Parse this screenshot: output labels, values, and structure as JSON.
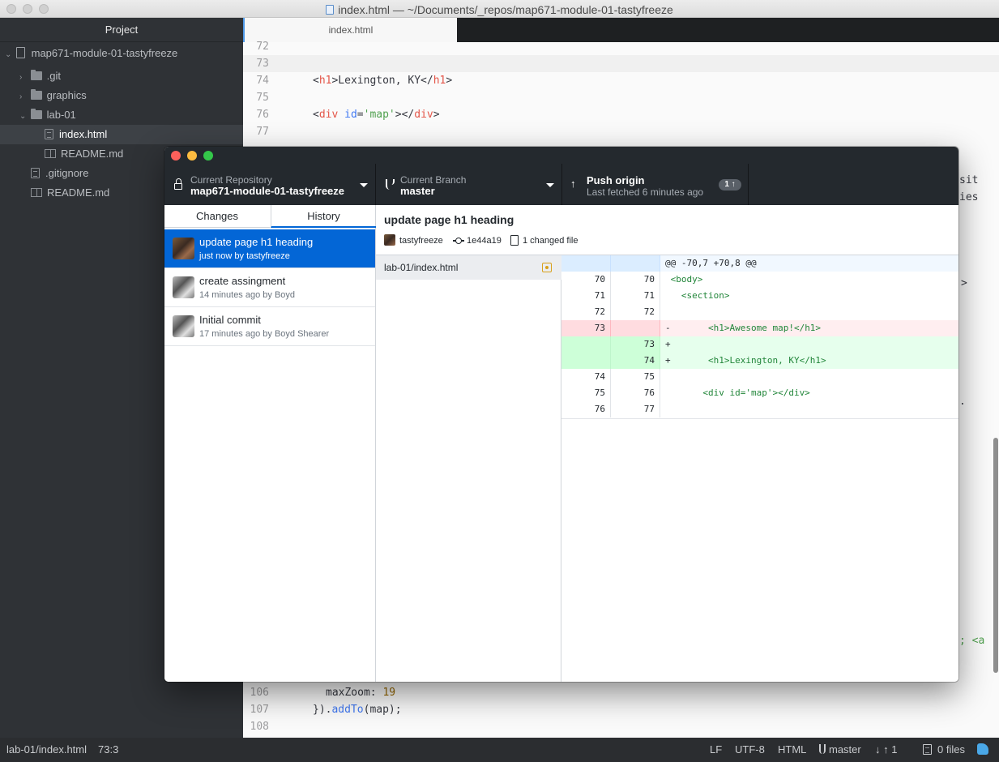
{
  "atom": {
    "window_title": "index.html — ~/Documents/_repos/map671-module-01-tastyfreeze",
    "tree": {
      "header": "Project",
      "root": "map671-module-01-tastyfreeze",
      "items": [
        {
          "label": ".git"
        },
        {
          "label": "graphics"
        },
        {
          "label": "lab-01"
        },
        {
          "label": "index.html"
        },
        {
          "label": "README.md"
        },
        {
          "label": ".gitignore"
        },
        {
          "label": "README.md"
        }
      ]
    },
    "tab": "index.html",
    "editor": {
      "lines": [
        {
          "n": "72"
        },
        {
          "n": "73"
        },
        {
          "n": "74",
          "open": "<",
          "tag": "h1",
          "mid": ">Lexington, KY</",
          "tag2": "h1",
          "close": ">"
        },
        {
          "n": "75"
        },
        {
          "n": "76",
          "open": "<",
          "tag": "div",
          "attr": "id",
          "eq": "=",
          "str": "'map'",
          "mid": "></",
          "tag2": "div",
          "close": ">"
        },
        {
          "n": "77"
        },
        {
          "n": "106",
          "key": "maxZoom",
          "colon": ": ",
          "num": "19"
        },
        {
          "n": "107",
          "pre": "}).",
          "fn": "addTo",
          "post": "(map);"
        },
        {
          "n": "108"
        }
      ],
      "right_fragments": [
        "sit",
        "ies",
        ">",
        ".",
        "; <a"
      ]
    },
    "status": {
      "file": "lab-01/index.html",
      "cursor": "73:3",
      "line_ending": "LF",
      "encoding": "UTF-8",
      "grammar": "HTML",
      "branch": "master",
      "up_count": "1",
      "files": "0 files"
    }
  },
  "github_desktop": {
    "toolbar": {
      "repo_label": "Current Repository",
      "repo_value": "map671-module-01-tastyfreeze",
      "branch_label": "Current Branch",
      "branch_value": "master",
      "push_title": "Push origin",
      "push_sub": "Last fetched 6 minutes ago",
      "push_badge": "1 ↑"
    },
    "tabs": [
      "Changes",
      "History"
    ],
    "commits": [
      {
        "title": "update page h1 heading",
        "meta": "just now by tastyfreeze"
      },
      {
        "title": "create assingment",
        "meta": "14 minutes ago by Boyd"
      },
      {
        "title": "Initial commit",
        "meta": "17 minutes ago by Boyd Shearer"
      }
    ],
    "selected_commit": {
      "summary": "update page h1 heading",
      "author": "tastyfreeze",
      "sha": "1e44a19",
      "changed": "1 changed file"
    },
    "files": [
      {
        "path": "lab-01/index.html",
        "status": "modified"
      }
    ],
    "diff": {
      "hunk": "@@ -70,7 +70,8 @@",
      "rows": [
        {
          "old": "70",
          "new": "70",
          "text": " <body>"
        },
        {
          "old": "71",
          "new": "71",
          "text": "   <section>"
        },
        {
          "old": "72",
          "new": "72",
          "text": ""
        },
        {
          "old": "73",
          "new": "",
          "sign": "-",
          "text": "       <h1>Awesome map!</h1>"
        },
        {
          "old": "",
          "new": "73",
          "sign": "+",
          "text": ""
        },
        {
          "old": "",
          "new": "74",
          "sign": "+",
          "text": "       <h1>Lexington, KY</h1>"
        },
        {
          "old": "74",
          "new": "75",
          "text": ""
        },
        {
          "old": "75",
          "new": "76",
          "text": "       <div id='map'></div>"
        },
        {
          "old": "76",
          "new": "77",
          "text": ""
        }
      ]
    }
  },
  "colors": {
    "accent": "#0366d6",
    "tree_bg": "#2f3236",
    "toolbar_bg": "#24292e",
    "deleted_bg": "#ffeef0",
    "added_bg": "#e6ffed",
    "close": "#fc605b",
    "minimize": "#fdbc40",
    "zoom": "#34c84a"
  },
  "icons": [
    "lock-icon",
    "branch-icon",
    "push-arrow-icon",
    "commit-icon",
    "file-diff-icon",
    "folder-icon",
    "file-icon",
    "book-icon",
    "repo-icon",
    "squirrel-icon"
  ]
}
